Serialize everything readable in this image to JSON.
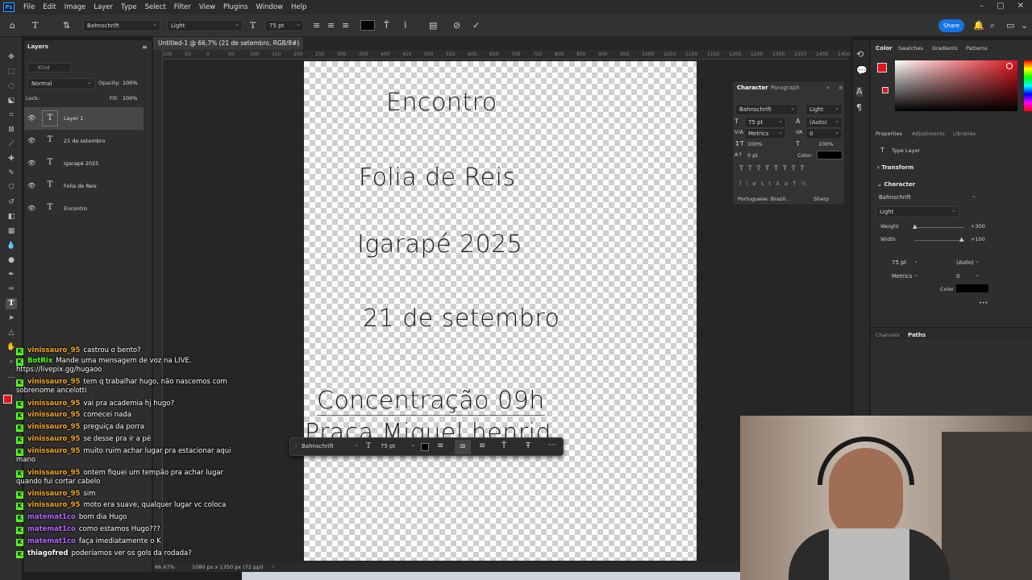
{
  "menubar": {
    "logo": "Ps",
    "items": [
      "File",
      "Edit",
      "Image",
      "Layer",
      "Type",
      "Select",
      "Filter",
      "View",
      "Plugins",
      "Window",
      "Help"
    ]
  },
  "options_bar": {
    "font_family": "Bahnschrift",
    "font_style": "Light",
    "font_size": "75 pt",
    "share": "Share"
  },
  "document": {
    "tab_title": "Untitled-1 @ 66,7% (21 de setembro, RGB/8#) *",
    "zoom": "66.67%",
    "doc_size": "1080 px x 1350 px (72 ppi)",
    "ruler_ticks": [
      "100",
      "50",
      "0",
      "50",
      "100",
      "150",
      "200",
      "250",
      "300",
      "350",
      "400",
      "450",
      "500",
      "550",
      "600",
      "650",
      "700",
      "750",
      "800",
      "850",
      "900",
      "950",
      "1000",
      "1050",
      "1100",
      "1150",
      "1200",
      "1250",
      "1300",
      "1350",
      "1400",
      "1450"
    ]
  },
  "canvas_text": {
    "line1": "Encontro",
    "line2": "Folia de Reis",
    "line3": "Igarapé 2025",
    "line4": "21 de setembro",
    "line5": "Concentração 09h",
    "line6": "Praça Miguel henriq"
  },
  "context_bar": {
    "font": "Bahnschrift",
    "size": "75 pt"
  },
  "layers_panel": {
    "title": "Layers",
    "kind": "Kind",
    "blend": "Normal",
    "opacity_label": "Opacity:",
    "opacity": "100%",
    "lock_label": "Lock:",
    "fill_label": "Fill:",
    "fill": "100%",
    "layers": [
      "Layer 1",
      "21 de setembro",
      "Igarapé 2025",
      "Folia de Reis",
      "Encontro"
    ]
  },
  "character_panel": {
    "tab1": "Character",
    "tab2": "Paragraph",
    "font": "Bahnschrift",
    "style": "Light",
    "size": "75 pt",
    "leading": "(Auto)",
    "kerning": "Metrics",
    "tracking": "0",
    "vscale": "100%",
    "hscale": "100%",
    "baseline": "0 pt",
    "color_label": "Color:",
    "language": "Portuguese: Brazil...",
    "aa": "Sharp"
  },
  "right_dock": {
    "color_tabs": [
      "Color",
      "Swatches",
      "Gradients",
      "Patterns"
    ],
    "prop_tabs": [
      "Properties",
      "Adjustments",
      "Libraries"
    ],
    "type_layer": "Type Layer",
    "transform": "Transform",
    "character": "Character",
    "font": "Bahnschrift",
    "style": "Light",
    "weight_label": "Weight",
    "weight": "+300",
    "width_label": "Width",
    "width": "+100",
    "size": "75 pt",
    "leading": "(Auto)",
    "kerning": "Metrics",
    "tracking": "0",
    "color_label": "Color",
    "bottom_tabs": [
      "Channels",
      "Paths"
    ],
    "fg_color": "#e0151f"
  },
  "chat": [
    {
      "user": "vinissauro_95",
      "color": "#f5a623",
      "text": "castrou o bento?"
    },
    {
      "user": "BotRix",
      "color": "#53fc18",
      "text": "Mande uma mensagem de voz na LIVE. https://livepix.gg/hugaoo"
    },
    {
      "user": "vinissauro_95",
      "color": "#f5a623",
      "text": "tem q trabalhar hugo, não nascemos com sobrenome ancelotti"
    },
    {
      "user": "vinissauro_95",
      "color": "#f5a623",
      "text": "vai pra academia hj hugo?"
    },
    {
      "user": "vinissauro_95",
      "color": "#f5a623",
      "text": "comecei nada"
    },
    {
      "user": "vinissauro_95",
      "color": "#f5a623",
      "text": "preguiça da porra"
    },
    {
      "user": "vinissauro_95",
      "color": "#f5a623",
      "text": "se desse pra ir a pé"
    },
    {
      "user": "vinissauro_95",
      "color": "#f5a623",
      "text": "muito ruim achar lugar pra estacionar aqui mano"
    },
    {
      "user": "vinissauro_95",
      "color": "#f5a623",
      "text": "ontem fiquei um tempão pra achar lugar quando fui cortar cabelo"
    },
    {
      "user": "vinissauro_95",
      "color": "#f5a623",
      "text": "sim"
    },
    {
      "user": "vinissauro_95",
      "color": "#f5a623",
      "text": "moto era suave, qualquer lugar vc coloca"
    },
    {
      "user": "matemat1co",
      "color": "#b266ff",
      "text": "bom dia Hugo"
    },
    {
      "user": "matemat1co",
      "color": "#b266ff",
      "text": "como estamos Hugo???"
    },
    {
      "user": "matemat1co",
      "color": "#b266ff",
      "text": "faça imediatamente o K"
    },
    {
      "user": "thiagofred",
      "color": "#ffffff",
      "text": "poderíamos ver os gols da rodada?"
    }
  ]
}
